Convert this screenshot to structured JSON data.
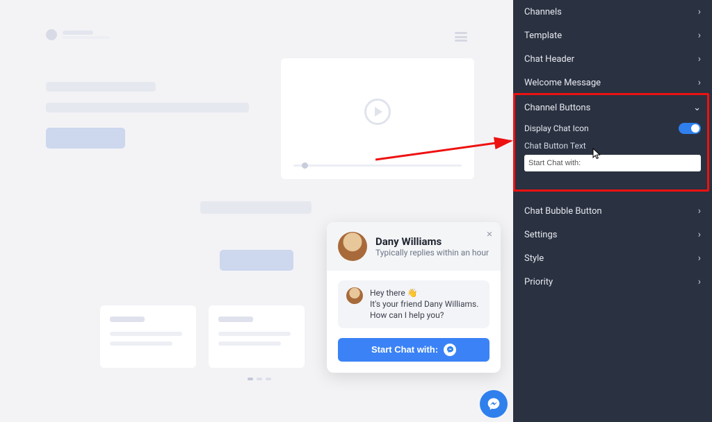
{
  "sidebar": {
    "items": [
      {
        "label": "Channels"
      },
      {
        "label": "Template"
      },
      {
        "label": "Chat Header"
      },
      {
        "label": "Welcome Message"
      }
    ],
    "open_section": {
      "title": "Channel Buttons",
      "display_chat_icon_label": "Display Chat Icon",
      "display_chat_icon_on": true,
      "chat_button_text_label": "Chat Button Text",
      "chat_button_text_value": "Start Chat with:"
    },
    "items_after": [
      {
        "label": "Chat Bubble Button"
      },
      {
        "label": "Settings"
      },
      {
        "label": "Style"
      },
      {
        "label": "Priority"
      }
    ]
  },
  "chat": {
    "agent_name": "Dany Williams",
    "reply_hint": "Typically replies within an hour",
    "greeting_line1": "Hey there 👋",
    "greeting_line2": "It's your friend Dany Williams. How can I help you?",
    "button_label": "Start Chat with:"
  }
}
